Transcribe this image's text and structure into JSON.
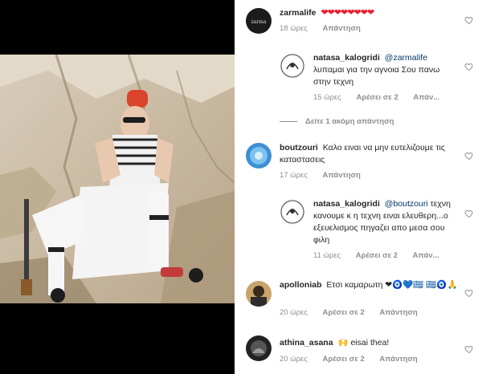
{
  "comments": [
    {
      "username": "zarmalife",
      "text": "",
      "emoji": "❤❤❤❤❤❤❤❤",
      "time": "18 ώρες",
      "reply": "Απάντηση",
      "likes": ""
    },
    {
      "username": "natasa_kalogridi",
      "mention": "@zarmalife",
      "text": "λυπαμαι για την αγνοια Σου πανω στην τεχνη",
      "time": "15 ώρες",
      "likes": "Αρέσει σε 2",
      "reply": "Απάν..."
    },
    {
      "username": "boutzouri",
      "text": "Καλο ειναι να μην ευτελιζουμε τις καταστασεις",
      "time": "17 ώρες",
      "reply": "Απάντηση",
      "likes": ""
    },
    {
      "username": "natasa_kalogridi",
      "mention": "@boutzouri",
      "text": "τεχνη κανουμε κ η τεχνη ειναι ελευθερη...ο εξευελισμος πηγαζει απο μεσα σου φιλη",
      "time": "11 ώρες",
      "likes": "Αρέσει σε 2",
      "reply": "Απάν..."
    },
    {
      "username": "apolloniab",
      "text": "Ετσι καμαρωτη",
      "emoji": "❤🧿💙🇬🇷 🇬🇷🧿🙏",
      "time": "20 ώρες",
      "likes": "Αρέσει σε 2",
      "reply": "Απάντηση"
    },
    {
      "username": "athina_asana",
      "text": "eisai thea!",
      "emoji": "🙌",
      "time": "20 ώρες",
      "likes": "Αρέσει σε 2",
      "reply": "Απάντηση"
    }
  ],
  "view_more_replies": "Δείτε 1 ακόμη απάντηση",
  "colors": {
    "heart_red": "#ed1d2e",
    "mention": "#00376b",
    "meta_gray": "#8e8e8e"
  }
}
